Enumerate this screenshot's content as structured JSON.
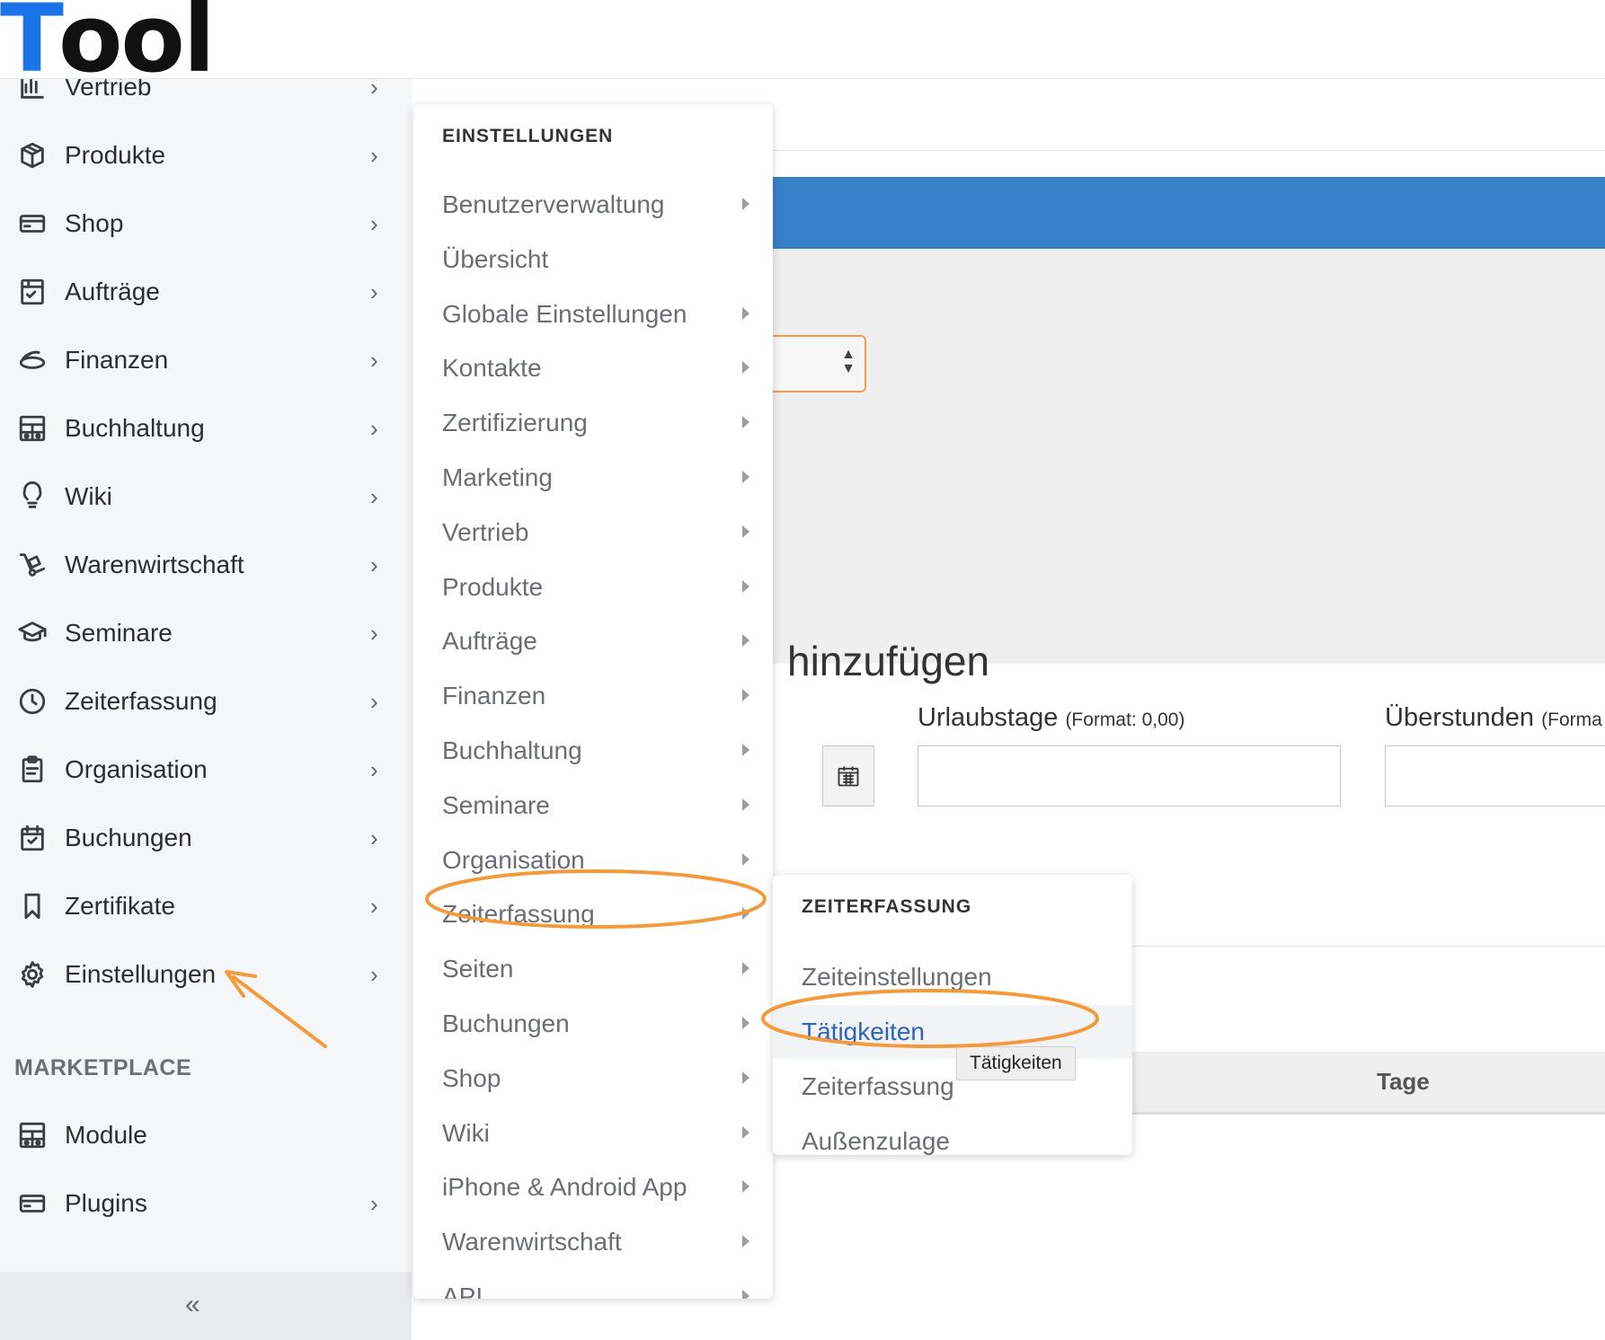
{
  "logo": {
    "first": "T",
    "rest": "ool"
  },
  "sidebar": {
    "items": [
      {
        "label": "Vertrieb",
        "icon": "chart-bar-icon"
      },
      {
        "label": "Produkte",
        "icon": "box-icon"
      },
      {
        "label": "Shop",
        "icon": "credit-card-icon"
      },
      {
        "label": "Aufträge",
        "icon": "order-icon"
      },
      {
        "label": "Finanzen",
        "icon": "coins-icon"
      },
      {
        "label": "Buchhaltung",
        "icon": "calculator-icon"
      },
      {
        "label": "Wiki",
        "icon": "lightbulb-icon"
      },
      {
        "label": "Warenwirtschaft",
        "icon": "hand-truck-icon"
      },
      {
        "label": "Seminare",
        "icon": "graduation-cap-icon"
      },
      {
        "label": "Zeiterfassung",
        "icon": "clock-icon"
      },
      {
        "label": "Organisation",
        "icon": "clipboard-icon"
      },
      {
        "label": "Buchungen",
        "icon": "calendar-check-icon"
      },
      {
        "label": "Zertifikate",
        "icon": "bookmark-icon"
      },
      {
        "label": "Einstellungen",
        "icon": "gear-icon"
      }
    ],
    "marketplace_title": "MARKETPLACE",
    "marketplace_items": [
      {
        "label": "Module",
        "icon": "calculator-icon"
      },
      {
        "label": "Plugins",
        "icon": "credit-card-icon"
      }
    ],
    "collapse_symbol": "«"
  },
  "main": {
    "heading": "hinzufügen",
    "urlaub_label": "Urlaubstage",
    "urlaub_format": "(Format: 0,00)",
    "ueberstunden_label": "Überstunden",
    "ueberstunden_format": "(Forma",
    "table_col_tage": "Tage"
  },
  "menu_settings": {
    "title": "EINSTELLUNGEN",
    "items": [
      {
        "label": "Benutzerverwaltung",
        "has_sub": true
      },
      {
        "label": "Übersicht",
        "has_sub": false
      },
      {
        "label": "Globale Einstellungen",
        "has_sub": true
      },
      {
        "label": "Kontakte",
        "has_sub": true
      },
      {
        "label": "Zertifizierung",
        "has_sub": true
      },
      {
        "label": "Marketing",
        "has_sub": true
      },
      {
        "label": "Vertrieb",
        "has_sub": true
      },
      {
        "label": "Produkte",
        "has_sub": true
      },
      {
        "label": "Aufträge",
        "has_sub": true
      },
      {
        "label": "Finanzen",
        "has_sub": true
      },
      {
        "label": "Buchhaltung",
        "has_sub": true
      },
      {
        "label": "Seminare",
        "has_sub": true
      },
      {
        "label": "Organisation",
        "has_sub": true
      },
      {
        "label": "Zeiterfassung",
        "has_sub": true
      },
      {
        "label": "Seiten",
        "has_sub": true
      },
      {
        "label": "Buchungen",
        "has_sub": true
      },
      {
        "label": "Shop",
        "has_sub": true
      },
      {
        "label": "Wiki",
        "has_sub": true
      },
      {
        "label": "iPhone & Android App",
        "has_sub": true
      },
      {
        "label": "Warenwirtschaft",
        "has_sub": true
      },
      {
        "label": "API",
        "has_sub": true
      }
    ]
  },
  "menu_zeiterfassung": {
    "title": "ZEITERFASSUNG",
    "items": [
      {
        "label": "Zeiteinstellungen"
      },
      {
        "label": "Tätigkeiten"
      },
      {
        "label": "Zeiterfassung"
      },
      {
        "label": "Außenzulage"
      }
    ],
    "tooltip": "Tätigkeiten"
  },
  "colors": {
    "accent_orange": "#F39A3C",
    "link_blue": "#2A63B8",
    "header_blue": "#3780C8",
    "logo_blue": "#1A73E8"
  }
}
